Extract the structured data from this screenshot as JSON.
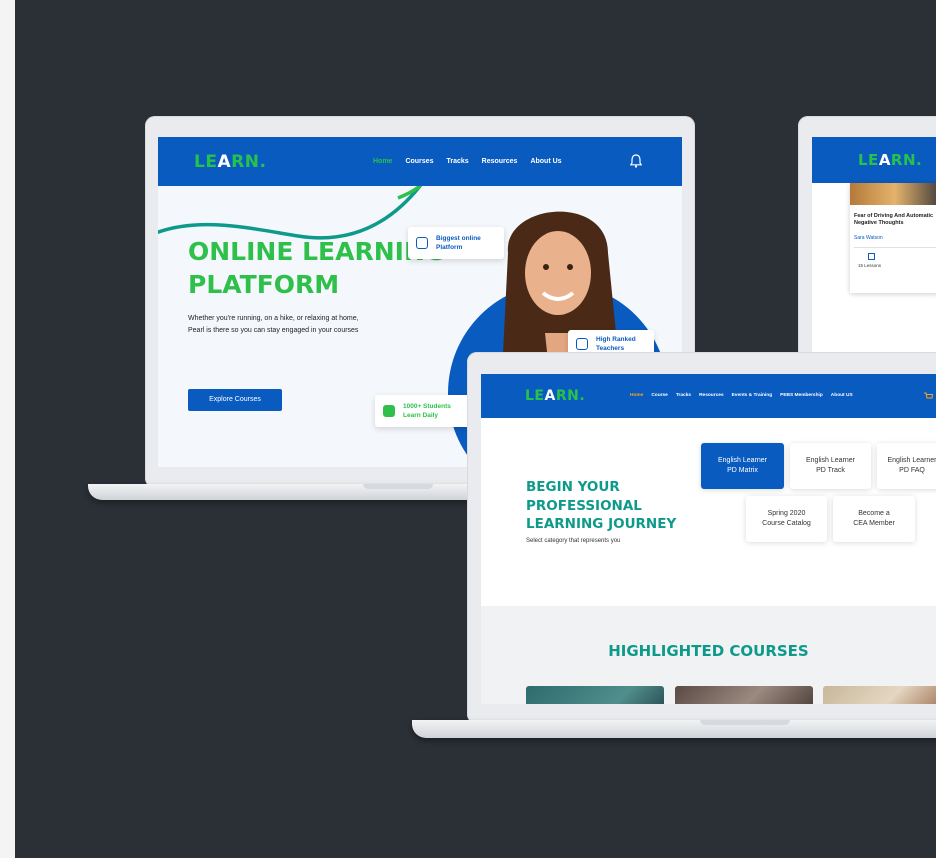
{
  "colors": {
    "background": "#2b2f36",
    "nav_blue": "#0a5bc0",
    "brand_green": "#2fc04b",
    "teal": "#0d9a8a"
  },
  "screen1": {
    "logo": {
      "part1": "LE",
      "part2": "A",
      "part3": "RN."
    },
    "nav": [
      "Home",
      "Courses",
      "Tracks",
      "Resources",
      "About Us"
    ],
    "bell_icon": "bell-icon",
    "hero_title_line1": "ONLINE LEARNING",
    "hero_title_line2": "PLATFORM",
    "hero_desc": "Whether you're running, on a hike, or relaxing at home, Pearl is there so you can stay engaged in your courses",
    "cta": "Explore Courses",
    "badge_platform": "Biggest online Platform",
    "badge_teachers": "High Ranked Teachers",
    "badge_students": "1000+ Students Learn Daily"
  },
  "screen2": {
    "logo": {
      "part1": "LE",
      "part2": "A",
      "part3": "RN."
    },
    "course_title": "Fear of Driving And Automatic Negative Thoughts",
    "author": "Sara Watson",
    "lessons": "15 Lessons"
  },
  "screen3": {
    "logo": {
      "part1": "LE",
      "part2": "A",
      "part3": "RN."
    },
    "nav": [
      "Home",
      "Course",
      "Tracks",
      "Resources",
      "Events & Training",
      "PEBS Membership",
      "About US"
    ],
    "title_line1": "BEGIN YOUR",
    "title_line2": "PROFESSIONAL",
    "title_line3": "LEARNING JOURNEY",
    "subtitle": "Select category that represents you",
    "cards": [
      {
        "line1": "English Learner",
        "line2": "PD Matrix"
      },
      {
        "line1": "English Learner",
        "line2": "PD Track"
      },
      {
        "line1": "English Learner",
        "line2": "PD FAQ"
      },
      {
        "line1": "Spring 2020",
        "line2": "Course Catalog"
      },
      {
        "line1": "Become a",
        "line2": "CEA Member"
      }
    ],
    "highlighted_title": "HIGHLIGHTED COURSES"
  }
}
